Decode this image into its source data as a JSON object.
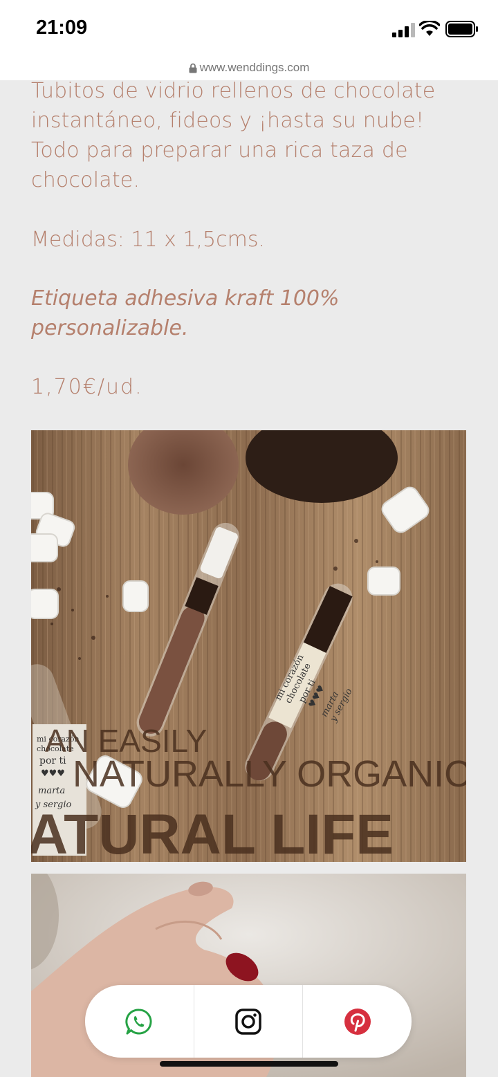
{
  "status": {
    "time": "21:09",
    "signal_icon": "signal-bars-icon",
    "wifi_icon": "wifi-icon",
    "battery_icon": "battery-icon"
  },
  "browser": {
    "url": "www.wenddings.com",
    "lock_icon": "lock-icon"
  },
  "product": {
    "description": "Tubitos de vidrio rellenos de chocolate instantáneo, fideos y ¡hasta su nube! Todo para preparar una rica taza de chocolate.",
    "measures": "Medidas: 11 x 1,5cms.",
    "label_note": "Etiqueta adhesiva kraft 100% personalizable.",
    "price": "1,70€/ud.",
    "text_color": "#b5806d"
  },
  "photo1": {
    "engraved_line1": "AN EASILY",
    "engraved_line2": "NATURALLY ORGANIC",
    "engraved_line3": "ATURAL LIFE",
    "tube_label_line1": "mi corazón",
    "tube_label_line2": "chocolate",
    "tube_label_line3": "por ti",
    "tube_label_line4": "♥♥♥",
    "tube_label_names1": "marta",
    "tube_label_names2": "y sergio"
  },
  "share": {
    "whatsapp_icon": "whatsapp-icon",
    "instagram_icon": "instagram-icon",
    "pinterest_icon": "pinterest-icon",
    "whatsapp_color": "#25a244",
    "instagram_color": "#111111",
    "pinterest_color": "#d6303f"
  }
}
